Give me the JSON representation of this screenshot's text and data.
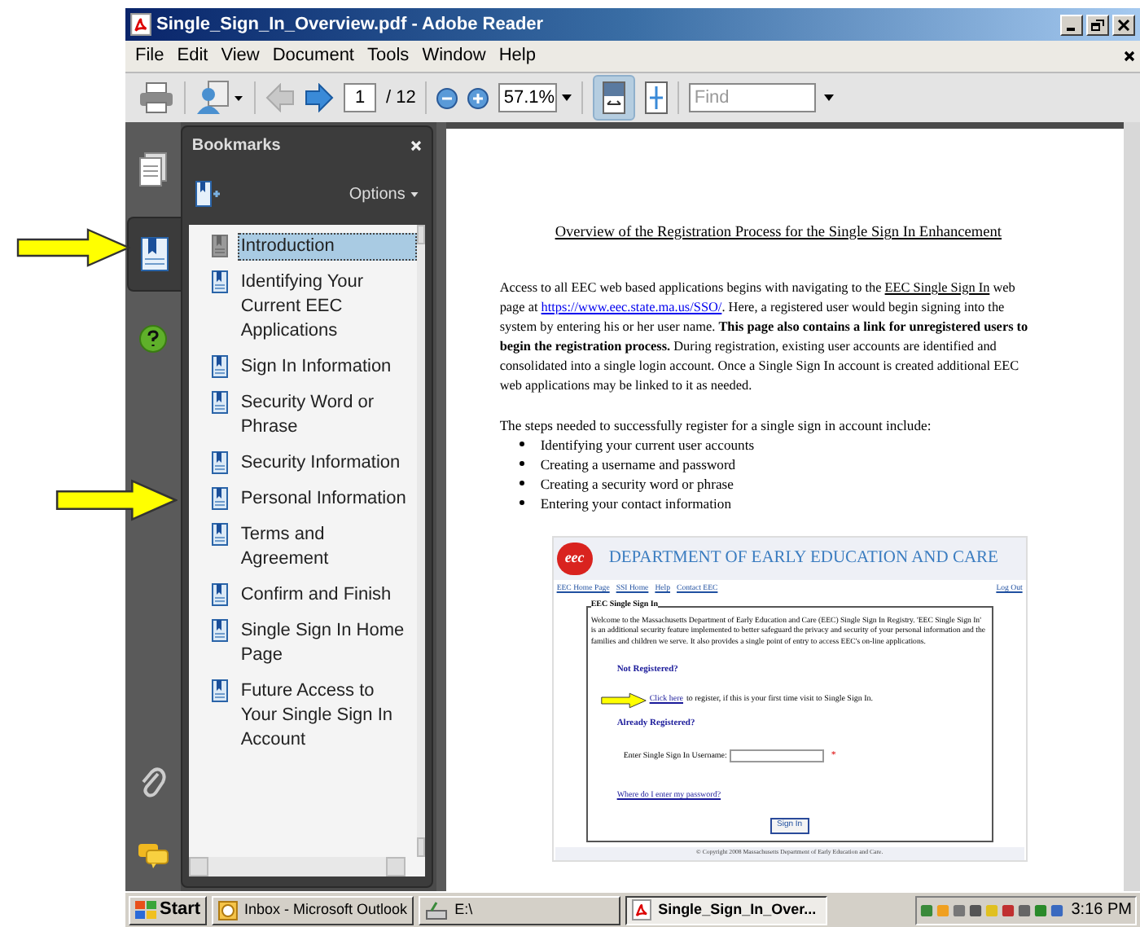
{
  "window": {
    "title": "Single_Sign_In_Overview.pdf - Adobe Reader"
  },
  "menu": [
    "File",
    "Edit",
    "View",
    "Document",
    "Tools",
    "Window",
    "Help"
  ],
  "toolbar": {
    "page": "1",
    "page_count": "/ 12",
    "zoom": "57.1%",
    "find_placeholder": "Find"
  },
  "side_tabs": [
    {
      "kind": "pages",
      "selected": false
    },
    {
      "kind": "bookmarks",
      "selected": true
    },
    {
      "kind": "help",
      "selected": false
    }
  ],
  "bookmarks": {
    "title": "Bookmarks",
    "options": "Options",
    "items": [
      {
        "label": "Introduction",
        "selected": true
      },
      {
        "label": "Identifying Your Current EEC Applications",
        "selected": false
      },
      {
        "label": "Sign In Information",
        "selected": false
      },
      {
        "label": "Security Word or Phrase",
        "selected": false
      },
      {
        "label": "Security Information",
        "selected": false
      },
      {
        "label": "Personal Information",
        "selected": false
      },
      {
        "label": "Terms and Agreement",
        "selected": false
      },
      {
        "label": "Confirm and Finish",
        "selected": false
      },
      {
        "label": "Single Sign In Home Page",
        "selected": false
      },
      {
        "label": "Future Access to Your Single Sign In Account",
        "selected": false
      }
    ]
  },
  "document": {
    "heading": "Overview of the Registration Process for the Single Sign In Enhancement",
    "paragraph": [
      {
        "kind": "text",
        "text": "Access to all EEC web based applications begins with navigating to the "
      },
      {
        "kind": "underline",
        "text": "EEC Single Sign In"
      },
      {
        "kind": "text",
        "text": " web page at "
      },
      {
        "kind": "link",
        "text": "https://www.eec.state.ma.us/SSO/"
      },
      {
        "kind": "text",
        "text": ". Here, a registered user would begin signing into the system by entering his or her user name. "
      },
      {
        "kind": "bold",
        "text": "This page also contains a link for unregistered users to begin the registration process."
      },
      {
        "kind": "text",
        "text": " During registration, existing user accounts are identified and consolidated into a single login account. Once a Single Sign In account is created additional EEC web applications may be linked to it as needed."
      }
    ],
    "steps_intro": "The steps needed to successfully register for a single sign in account include:",
    "steps": [
      "Identifying your current user accounts",
      "Creating a username and password",
      "Creating a security word or phrase",
      "Entering your contact information"
    ],
    "embedded": {
      "logo": "eec",
      "org": "DEPARTMENT OF EARLY EDUCATION AND CARE",
      "nav": [
        "EEC Home Page",
        "SSI Home",
        "Help",
        "Contact EEC"
      ],
      "logout": "Log Out",
      "legend": "EEC Single Sign In",
      "welcome": "Welcome to the Massachusetts Department of Early Education and Care (EEC) Single Sign In Registry. 'EEC Single Sign In' is an additional security feature implemented to better safeguard the privacy and security of your personal information and the families and children we serve. It also provides a single point of entry to access EEC's on-line applications.",
      "not_registered": "Not Registered?",
      "click_here": "Click here",
      "register_text": "to register, if this is your first time visit to Single Sign In.",
      "already": "Already Registered?",
      "username_label": "Enter Single Sign In Username:",
      "required": "*",
      "password_link": "Where do I enter my password?",
      "sign_in": "Sign In",
      "copyright": "© Copyright 2008 Massachusetts Department of Early Education and Care."
    }
  },
  "taskbar": {
    "start": "Start",
    "tasks": [
      {
        "label": "Inbox - Microsoft Outlook",
        "kind": "mail",
        "selected": false
      },
      {
        "label": "E:\\",
        "kind": "drive",
        "selected": false
      },
      {
        "label": "Single_Sign_In_Over...",
        "kind": "pdf",
        "selected": true
      }
    ],
    "clock": "3:16 PM"
  }
}
